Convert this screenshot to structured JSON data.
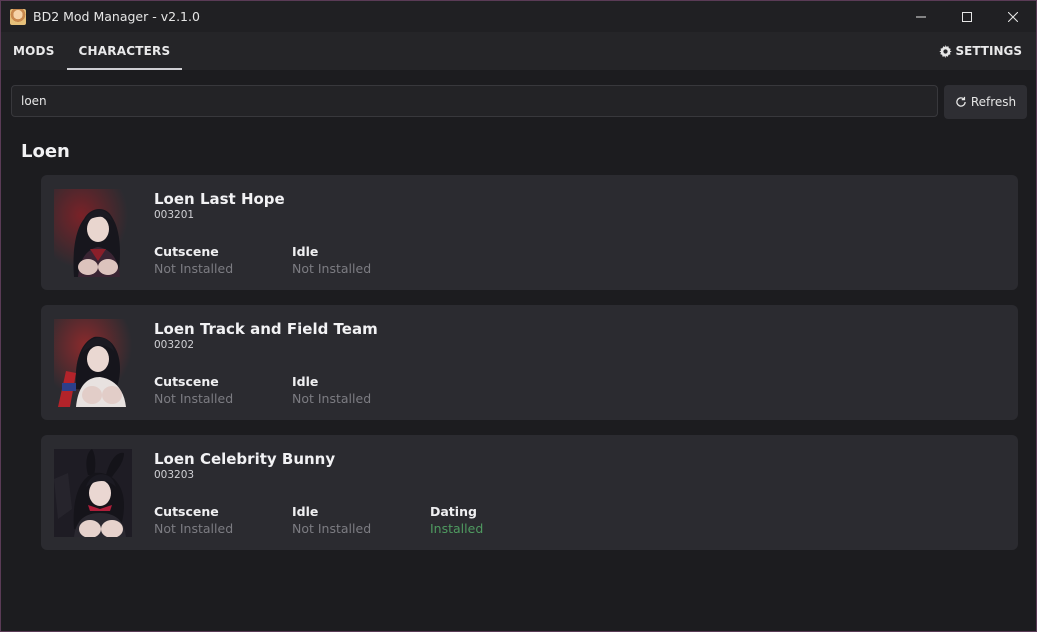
{
  "window": {
    "title": "BD2 Mod Manager - v2.1.0"
  },
  "nav": {
    "tabs": [
      {
        "label": "MODS",
        "active": false
      },
      {
        "label": "CHARACTERS",
        "active": true
      }
    ],
    "settings_label": "SETTINGS"
  },
  "search": {
    "value": "loen",
    "placeholder": ""
  },
  "refresh_label": "Refresh",
  "group": {
    "title": "Loen"
  },
  "characters": [
    {
      "name": "Loen Last Hope",
      "id": "003201",
      "mods": [
        {
          "label": "Cutscene",
          "status": "Not Installed"
        },
        {
          "label": "Idle",
          "status": "Not Installed"
        }
      ]
    },
    {
      "name": "Loen Track and Field Team",
      "id": "003202",
      "mods": [
        {
          "label": "Cutscene",
          "status": "Not Installed"
        },
        {
          "label": "Idle",
          "status": "Not Installed"
        }
      ]
    },
    {
      "name": "Loen Celebrity Bunny",
      "id": "003203",
      "mods": [
        {
          "label": "Cutscene",
          "status": "Not Installed"
        },
        {
          "label": "Idle",
          "status": "Not Installed"
        },
        {
          "label": "Dating",
          "status": "Installed"
        }
      ]
    }
  ],
  "colors": {
    "installed": "#4f9a60",
    "not_installed": "#7c7c82",
    "card_bg": "#2b2b30",
    "window_bg": "#1c1c1f",
    "border_accent": "#5a3b56"
  },
  "icons": {
    "app": "app-icon",
    "minimize": "minimize-icon",
    "maximize": "maximize-icon",
    "close": "close-icon",
    "settings": "gear-icon",
    "refresh": "refresh-icon"
  }
}
